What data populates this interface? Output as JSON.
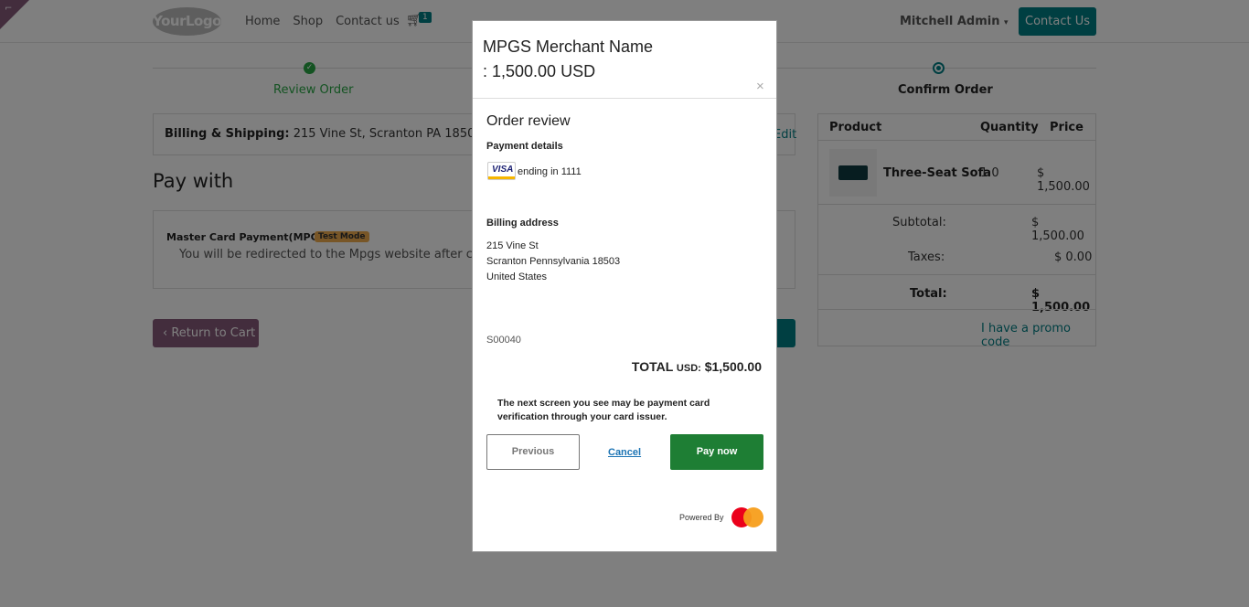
{
  "header": {
    "logo": "YourLogo",
    "nav": [
      "Home",
      "Shop",
      "Contact us"
    ],
    "cart_count": "1",
    "user": "Mitchell Admin",
    "contact_button": "Contact Us"
  },
  "steps": {
    "review": "Review Order",
    "confirm": "Confirm Order"
  },
  "billing": {
    "label": "Billing & Shipping:",
    "address": "215 Vine St, Scranton PA 18503, United States",
    "edit": "Edit"
  },
  "pay_with": {
    "title": "Pay with",
    "method": "Master Card Payment(MPGS)",
    "badge": "Test Mode",
    "description": "You will be redirected to the Mpgs website after clicking on the payment button."
  },
  "actions": {
    "return_to_cart": "Return to Cart"
  },
  "order": {
    "headers": [
      "Product",
      "Quantity",
      "Price"
    ],
    "product_name": "Three-Seat Sofa",
    "quantity": "1.0",
    "price": "$ 1,500.00",
    "subtotal_label": "Subtotal:",
    "subtotal": "$ 1,500.00",
    "taxes_label": "Taxes:",
    "taxes": "$ 0.00",
    "total_label": "Total:",
    "total": "$ 1,500.00",
    "promo": "I have a promo code"
  },
  "modal": {
    "title_line1": "MPGS Merchant Name",
    "title_line2": ": 1,500.00 USD",
    "close": "×",
    "heading": "Order review",
    "payment_details": "Payment details",
    "card_brand": "VISA",
    "card_text": "ending in 1111",
    "billing_heading": "Billing address",
    "address_lines": [
      "215 Vine St",
      "Scranton Pennsylvania 18503",
      "United States"
    ],
    "reference": "S00040",
    "total_label": "TOTAL",
    "total_currency": "USD:",
    "total_amount": "$1,500.00",
    "note": "The next screen you see may be payment card verification through your card issuer.",
    "previous": "Previous",
    "cancel": "Cancel",
    "pay_now": "Pay now",
    "powered_by": "Powered By"
  }
}
